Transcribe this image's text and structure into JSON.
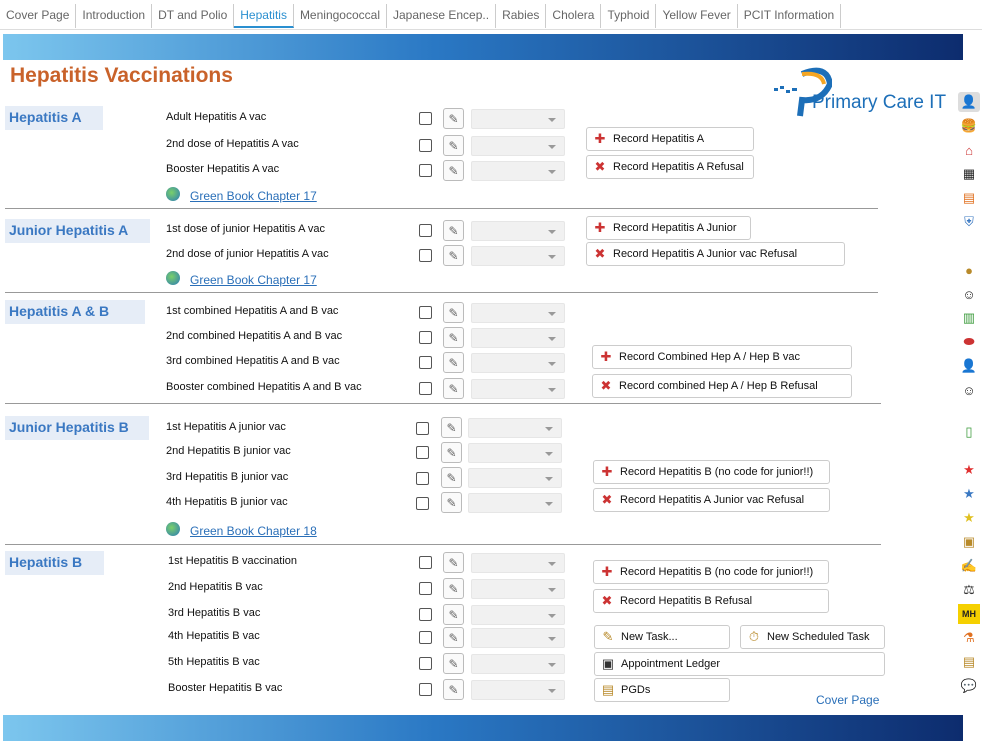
{
  "tabs": [
    "Cover Page",
    "Introduction",
    "DT and Polio",
    "Hepatitis",
    "Meningococcal",
    "Japanese Encep..",
    "Rabies",
    "Cholera",
    "Typhoid",
    "Yellow Fever",
    "PCIT Information"
  ],
  "active_tab": "Hepatitis",
  "title": "Hepatitis Vaccinations",
  "logo": {
    "text": "Primary Care IT"
  },
  "green_book_17": "Green Book Chapter 17",
  "green_book_18": "Green Book Chapter 18",
  "sections": {
    "hepa": {
      "title": "Hepatitis A",
      "rows": [
        "Adult Hepatitis A vac",
        "2nd dose of Hepatitis A vac",
        "Booster Hepatitis A vac"
      ],
      "buttons": [
        "Record Hepatitis A",
        "Record Hepatitis A Refusal"
      ]
    },
    "jhepa": {
      "title": "Junior Hepatitis A",
      "rows": [
        "1st dose of junior Hepatitis A vac",
        "2nd dose of junior Hepatitis A vac"
      ],
      "buttons": [
        "Record Hepatitis A Junior",
        "Record Hepatitis A Junior vac Refusal"
      ]
    },
    "hepab": {
      "title": "Hepatitis A & B",
      "rows": [
        "1st combined Hepatitis A and B vac",
        "2nd combined Hepatitis A and B vac",
        "3rd combined Hepatitis A and B vac",
        "Booster combined Hepatitis A and B vac"
      ],
      "buttons": [
        "Record Combined Hep A / Hep B vac",
        "Record combined Hep A / Hep B Refusal"
      ]
    },
    "jhepb": {
      "title": "Junior Hepatitis B",
      "rows": [
        "1st Hepatitis A junior vac",
        "2nd Hepatitis B junior vac",
        "3rd Hepatitis B junior vac",
        "4th Hepatitis B junior vac"
      ],
      "buttons": [
        "Record Hepatitis B (no code for junior!!)",
        "Record Hepatitis A Junior vac Refusal"
      ]
    },
    "hepb": {
      "title": "Hepatitis B",
      "rows": [
        "1st Hepatitis B vaccination",
        "2nd Hepatitis B vac",
        "3rd Hepatitis B vac",
        "4th Hepatitis B vac",
        "5th Hepatitis B vac",
        "Booster Hepatitis B vac"
      ],
      "buttons": [
        "Record Hepatitis B (no code for junior!!)",
        "Record Hepatitis B Refusal"
      ]
    }
  },
  "actions": {
    "new_task": "New Task...",
    "new_scheduled_task": "New Scheduled Task",
    "appointment_ledger": "Appointment Ledger",
    "pgds": "PGDs"
  },
  "cover_page_link": "Cover Page",
  "colors": {
    "accent": "#2a8fd0",
    "title": "#c9622a",
    "section": "#3a78c2"
  }
}
